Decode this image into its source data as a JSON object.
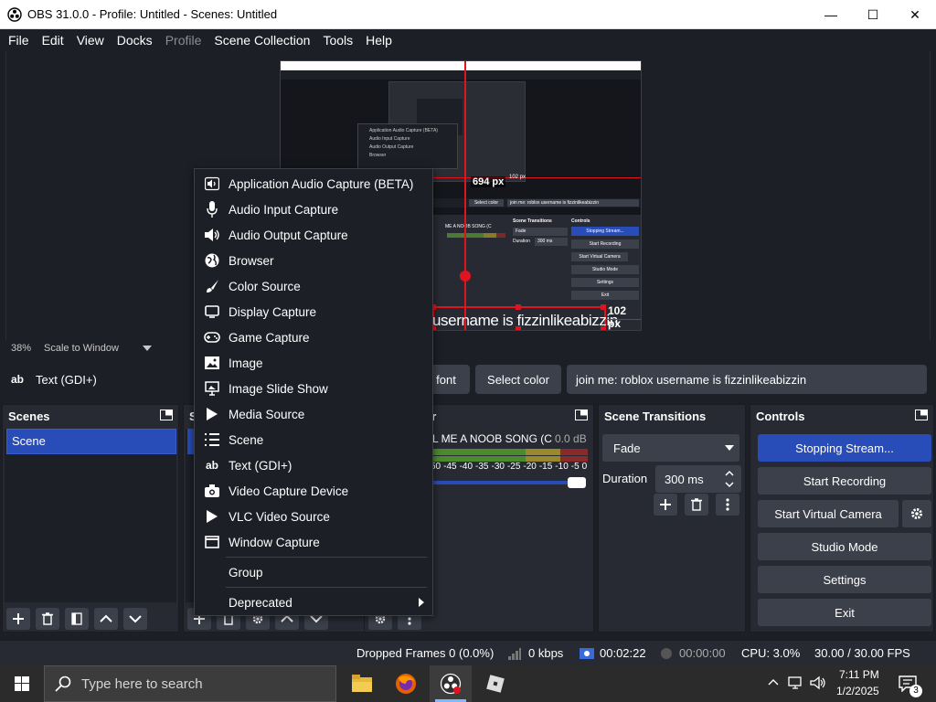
{
  "window": {
    "title": "OBS 31.0.0 - Profile: Untitled - Scenes: Untitled",
    "minimize": "—",
    "maximize": "☐",
    "close": "✕"
  },
  "menu": [
    "File",
    "Edit",
    "View",
    "Docks",
    "Profile",
    "Scene Collection",
    "Tools",
    "Help"
  ],
  "preview": {
    "zoom": "38%",
    "scale_mode": "Scale to Window",
    "overlay_text": "username is fizzinlikeabizzin",
    "width_label": "694 px",
    "height_label": "102 px",
    "inner_width_label": "694 px",
    "inner_text": "join me: roblox username is fizzinlikeabizzin"
  },
  "source_toolbar": {
    "source_name": "Text (GDI+)",
    "font_button": "font",
    "color_button": "Select color",
    "text_value": "join me: roblox username is fizzinlikeabizzin"
  },
  "docks": {
    "scenes": {
      "title": "Scenes",
      "items": [
        "Scene"
      ]
    },
    "sources": {
      "title_partial": "S"
    },
    "audio": {
      "title_partial": "er",
      "track_name": "L ME A NOOB SONG (C",
      "db": "0.0 dB",
      "ticks": [
        "50",
        "-45",
        "-40",
        "-35",
        "-30",
        "-25",
        "-20",
        "-15",
        "-10",
        "-5",
        "0"
      ]
    },
    "transitions": {
      "title": "Scene Transitions",
      "selected": "Fade",
      "duration_label": "Duration",
      "duration_value": "300 ms"
    },
    "controls": {
      "title": "Controls",
      "buttons": [
        "Stopping Stream...",
        "Start Recording",
        "Start Virtual Camera",
        "Studio Mode",
        "Settings",
        "Exit"
      ]
    }
  },
  "context_menu": {
    "items": [
      {
        "label": "Application Audio Capture (BETA)",
        "icon": "app-audio-icon"
      },
      {
        "label": "Audio Input Capture",
        "icon": "microphone-icon"
      },
      {
        "label": "Audio Output Capture",
        "icon": "speaker-icon"
      },
      {
        "label": "Browser",
        "icon": "globe-icon"
      },
      {
        "label": "Color Source",
        "icon": "brush-icon"
      },
      {
        "label": "Display Capture",
        "icon": "monitor-icon"
      },
      {
        "label": "Game Capture",
        "icon": "gamepad-icon"
      },
      {
        "label": "Image",
        "icon": "image-icon"
      },
      {
        "label": "Image Slide Show",
        "icon": "slideshow-icon"
      },
      {
        "label": "Media Source",
        "icon": "play-icon"
      },
      {
        "label": "Scene",
        "icon": "list-icon"
      },
      {
        "label": "Text (GDI+)",
        "icon": "text-icon"
      },
      {
        "label": "Video Capture Device",
        "icon": "camera-icon"
      },
      {
        "label": "VLC Video Source",
        "icon": "play-icon"
      },
      {
        "label": "Window Capture",
        "icon": "window-icon"
      }
    ],
    "group": "Group",
    "deprecated": "Deprecated"
  },
  "inner_context_menu": [
    "Application Audio Capture (BETA)",
    "Audio Input Capture",
    "Audio Output Capture",
    "Browser"
  ],
  "inner_controls": [
    "Stopping Stream...",
    "Start Recording",
    "Start Virtual Camera",
    "Studio Mode",
    "Settings",
    "Exit"
  ],
  "inner_labels": {
    "scene_transitions": "Scene Transitions",
    "controls": "Controls",
    "fade": "Fade",
    "duration": "Duration",
    "duration_value": "300 ms",
    "select_color": "Select color",
    "track": "ME A NOOB SONG (C"
  },
  "status": {
    "dropped_frames": "Dropped Frames 0 (0.0%)",
    "bitrate": "0 kbps",
    "stream_time": "00:02:22",
    "rec_time": "00:00:00",
    "cpu": "CPU: 3.0%",
    "fps": "30.00 / 30.00 FPS"
  },
  "taskbar": {
    "search_placeholder": "Type here to search",
    "time": "7:11 PM",
    "date": "1/2/2025",
    "notification_count": "3"
  },
  "colors": {
    "accent": "#284cb8",
    "panel": "#272a33",
    "bg": "#1d1f26",
    "button": "#3c404b",
    "red_guide": "#e0141e"
  }
}
